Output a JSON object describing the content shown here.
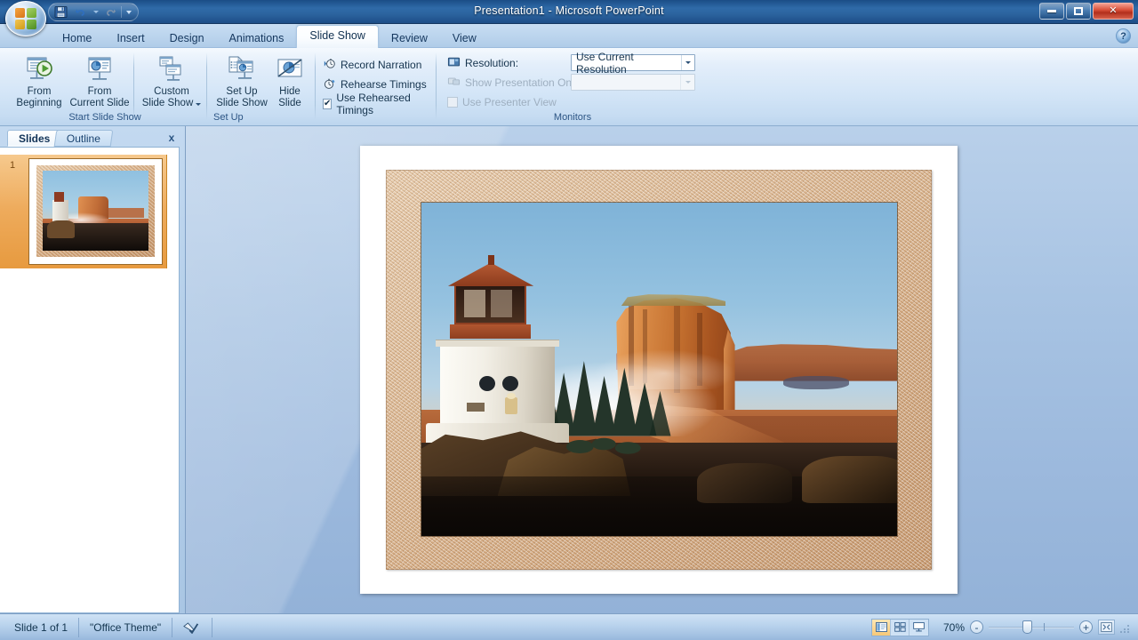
{
  "window": {
    "title": "Presentation1 - Microsoft PowerPoint",
    "minimize_label": "Minimize",
    "maximize_label": "Maximize",
    "close_label": "Close",
    "accent_blue": "#2f6aa8",
    "close_red": "#c9452c"
  },
  "quick_access": {
    "items": [
      {
        "name": "save-icon",
        "label": "Save"
      },
      {
        "name": "undo-icon",
        "label": "Undo"
      },
      {
        "name": "undo-dropdown-icon",
        "label": "Undo options"
      },
      {
        "name": "redo-icon",
        "label": "Redo"
      },
      {
        "name": "customize-qat-icon",
        "label": "Customize Quick Access Toolbar"
      }
    ]
  },
  "office_button": {
    "label": "Office Button"
  },
  "ribbon_tabs": {
    "items": [
      {
        "label": "Home",
        "active": false
      },
      {
        "label": "Insert",
        "active": false
      },
      {
        "label": "Design",
        "active": false
      },
      {
        "label": "Animations",
        "active": false
      },
      {
        "label": "Slide Show",
        "active": true
      },
      {
        "label": "Review",
        "active": false
      },
      {
        "label": "View",
        "active": false
      }
    ],
    "help_label": "?"
  },
  "ribbon": {
    "groups": [
      {
        "name": "start-slide-show",
        "label": "Start Slide Show",
        "buttons": [
          {
            "name": "from-beginning",
            "line1": "From",
            "line2": "Beginning",
            "icon": "slideshow-play-icon"
          },
          {
            "name": "from-current-slide",
            "line1": "From",
            "line2": "Current Slide",
            "icon": "slideshow-current-icon"
          },
          {
            "name": "custom-slide-show",
            "line1": "Custom",
            "line2": "Slide Show",
            "icon": "custom-slideshow-icon",
            "has_dropdown": true
          }
        ]
      },
      {
        "name": "set-up",
        "label": "Set Up",
        "buttons": [
          {
            "name": "set-up-slide-show",
            "line1": "Set Up",
            "line2": "Slide Show",
            "icon": "setup-slideshow-icon"
          },
          {
            "name": "hide-slide",
            "line1": "Hide",
            "line2": "Slide",
            "icon": "hide-slide-icon"
          }
        ],
        "items": [
          {
            "name": "record-narration",
            "label": "Record Narration",
            "icon": "microphone-icon",
            "type": "command",
            "disabled": false
          },
          {
            "name": "rehearse-timings",
            "label": "Rehearse Timings",
            "icon": "stopwatch-icon",
            "type": "command",
            "disabled": false
          },
          {
            "name": "use-rehearsed-timings",
            "label": "Use Rehearsed Timings",
            "icon": "checkbox-icon",
            "type": "checkbox",
            "checked": true,
            "disabled": false
          }
        ]
      },
      {
        "name": "monitors",
        "label": "Monitors",
        "items": [
          {
            "name": "resolution",
            "label": "Resolution:",
            "icon": "monitor-icon",
            "type": "label",
            "disabled": false
          },
          {
            "name": "show-presentation-on",
            "label": "Show Presentation On:",
            "icon": "monitors-icon",
            "type": "label",
            "disabled": true
          },
          {
            "name": "use-presenter-view",
            "label": "Use Presenter View",
            "icon": "checkbox-icon",
            "type": "checkbox",
            "checked": false,
            "disabled": true
          }
        ],
        "combos": [
          {
            "name": "resolution-combo",
            "value": "Use Current Resolution",
            "disabled": false
          },
          {
            "name": "show-presentation-on-combo",
            "value": "",
            "disabled": true
          }
        ]
      }
    ]
  },
  "left_pane": {
    "tabs": [
      {
        "name": "slides",
        "label": "Slides",
        "active": true
      },
      {
        "name": "outline",
        "label": "Outline",
        "active": false
      }
    ],
    "close_label": "x",
    "thumbnails": [
      {
        "number": "1",
        "selected": true,
        "alt": "Lighthouse and desert mesa photo in textured frame"
      }
    ]
  },
  "slide": {
    "number": "1",
    "content_description": "Framed photograph of a white lighthouse on a rocky headland with a sunlit red sandstone mesa and misty desert valley behind it",
    "frame_color": "#d8b58c",
    "sky_color": "#8fbcdc",
    "mesa_color": "#b45f32"
  },
  "status_bar": {
    "slide_counter": "Slide 1 of 1",
    "theme": "\"Office Theme\"",
    "spellcheck_label": "Spelling check",
    "views": [
      {
        "name": "normal-view",
        "label": "Normal",
        "active": true
      },
      {
        "name": "slide-sorter-view",
        "label": "Slide Sorter",
        "active": false
      },
      {
        "name": "slide-show-view",
        "label": "Slide Show",
        "active": false
      }
    ],
    "zoom_level": "70%",
    "zoom_out_label": "-",
    "zoom_in_label": "+",
    "fit_to_window_label": "Fit slide to current window"
  }
}
